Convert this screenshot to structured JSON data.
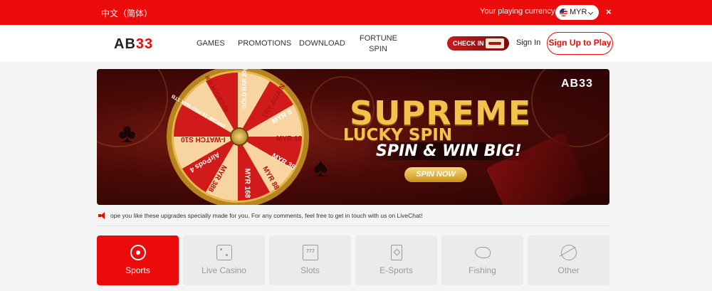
{
  "topbar": {
    "language": "中文（简体）",
    "currency_label": "Your playing currency",
    "currency": "MYR",
    "close_label": "×"
  },
  "header": {
    "logo_ab": "AB",
    "logo_num": "33",
    "nav": {
      "games": "GAMES",
      "promotions": "PROMOTIONS",
      "download": "DOWNLOAD",
      "fortune_line1": "FORTUNE",
      "fortune_line2": "SPIN"
    },
    "check_in": "CHECK IN",
    "sign_in": "Sign In",
    "sign_up": "Sign Up to Play"
  },
  "banner": {
    "logo": "AB33",
    "title": "SUPREME",
    "subtitle": "LUCKY SPIN",
    "tagline": "SPIN & WIN BIG!",
    "cta": "SPIN NOW",
    "wheel_labels": [
      "TRY AGAIN",
      "MYR 8",
      "MYR 18",
      "MYR 38",
      "MYR 88",
      "MYR 168",
      "MYR 388",
      "AirPods 4",
      "I-WATCH S10",
      "IPHONE 16 PRO MAX 1TB",
      "MACBOOK AIR",
      "GOLD BAR 20g"
    ]
  },
  "announcement": "ope you like these upgrades specially made for you. For any comments, feel free to get in touch with us on LiveChat!",
  "categories": [
    {
      "label": "Sports",
      "icon": "soccer-ball-icon",
      "active": true
    },
    {
      "label": "Live Casino",
      "icon": "dice-icon",
      "active": false
    },
    {
      "label": "Slots",
      "icon": "slot-machine-icon",
      "active": false
    },
    {
      "label": "E-Sports",
      "icon": "card-icon",
      "active": false
    },
    {
      "label": "Fishing",
      "icon": "fish-icon",
      "active": false
    },
    {
      "label": "Other",
      "icon": "planet-icon",
      "active": false
    }
  ],
  "colors": {
    "brand_red": "#ec0b0b",
    "gold": "#f2c24a"
  }
}
